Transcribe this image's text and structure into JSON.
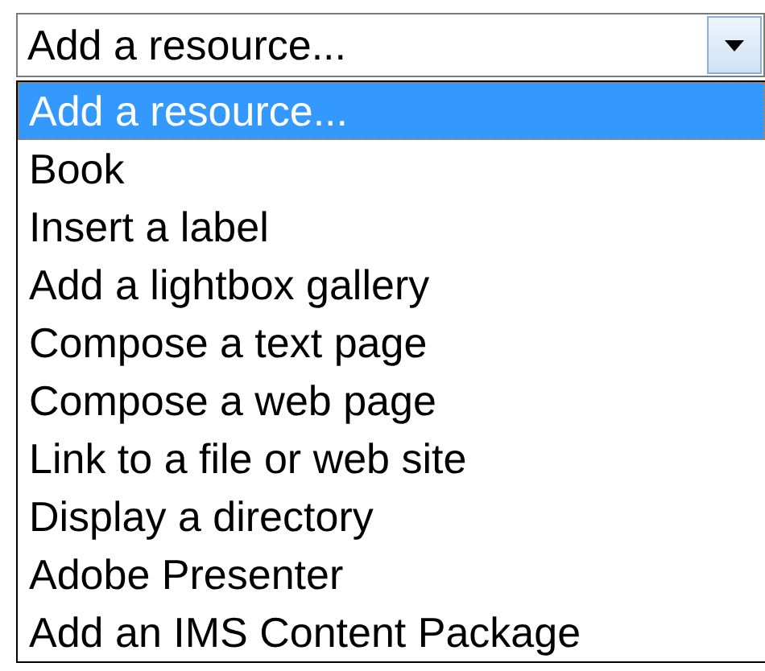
{
  "select": {
    "value": "Add a resource...",
    "expanded": true
  },
  "options": [
    {
      "label": "Add a resource...",
      "selected": true
    },
    {
      "label": "Book",
      "selected": false
    },
    {
      "label": "Insert a label",
      "selected": false
    },
    {
      "label": "Add a lightbox gallery",
      "selected": false
    },
    {
      "label": "Compose a text page",
      "selected": false
    },
    {
      "label": "Compose a web page",
      "selected": false
    },
    {
      "label": "Link to a file or web site",
      "selected": false
    },
    {
      "label": "Display a directory",
      "selected": false
    },
    {
      "label": "Adobe Presenter",
      "selected": false
    },
    {
      "label": "Add an IMS Content Package",
      "selected": false
    }
  ]
}
